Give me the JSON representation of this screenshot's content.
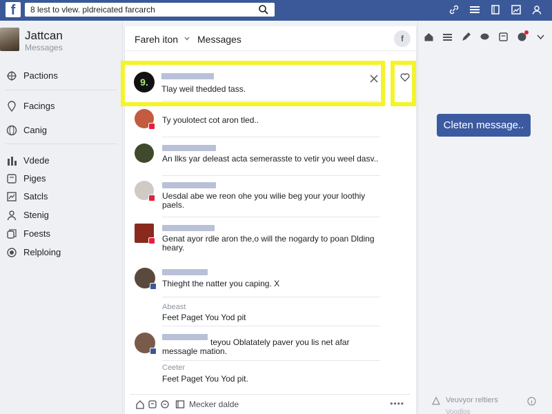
{
  "topbar": {
    "logo": "f",
    "search_value": "8 lest to vlew. pldreicated farcarch"
  },
  "profile": {
    "name": "Jattcan",
    "subtitle": "Messages"
  },
  "sidebar": {
    "items": [
      {
        "label": "Pactions",
        "icon": "gear-icon"
      },
      {
        "label": "Facings",
        "icon": "location-pin-icon"
      },
      {
        "label": "Canig",
        "icon": "globe-icon"
      },
      {
        "label": "Vdede",
        "icon": "bars-icon"
      },
      {
        "label": "Piges",
        "icon": "page-icon"
      },
      {
        "label": "Satcls",
        "icon": "chart-icon"
      },
      {
        "label": "Stenig",
        "icon": "person-icon"
      },
      {
        "label": "Foests",
        "icon": "copy-icon"
      },
      {
        "label": "Relploing",
        "icon": "circle-dot-icon"
      }
    ]
  },
  "messages_panel": {
    "recent_label": "Fareh iton",
    "title": "Messages",
    "header_icon": "f"
  },
  "highlighted_message": {
    "avatar_text": "9.",
    "text": "Tlay weil thedded tass."
  },
  "messages": [
    {
      "text": "Ty youlotect cot aron tled..",
      "avatar_color": "#c25b3f",
      "badge_color": "#e41e3f"
    },
    {
      "text": "An llks yar deleast acta semerasste to vetir you weel dasv..",
      "avatar_color": "#3f4a2c",
      "badge_color": ""
    },
    {
      "text": "Uesdal abe we reon ohe you wilie beg your your loothiy paels.",
      "avatar_color": "#cfcac4",
      "badge_color": "#e41e3f"
    },
    {
      "text": "Genat ayor rdle aron the,o will the nogardy to poan Dlding heary.",
      "avatar_color": "#8a2a1f",
      "badge_color": "#e41e3f"
    },
    {
      "text": "Thieght the natter you caping.  X",
      "sub_label": "Abeast",
      "sub_text": "Feet Paget You Yod pit",
      "avatar_color": "#5a4a3d",
      "badge_color": "#3b5998"
    },
    {
      "text": "teyou Oblatately paver you lis net afar messagle mation.",
      "sub_label": "Ceeter",
      "sub_text": "Feet Paget You Yod pit.",
      "avatar_color": "#7a5a4a",
      "badge_color": "#3b5998"
    }
  ],
  "composer": {
    "placeholder": "Mecker dalde",
    "more": "••••"
  },
  "right_panel": {
    "new_message_button": "Cleten message..",
    "footer_text": "Veuvyor reltiers",
    "footer_sub": "Voodlos"
  },
  "colors": {
    "brand": "#3b5998",
    "highlight": "#f4f42a",
    "button": "#3b5aa0"
  }
}
